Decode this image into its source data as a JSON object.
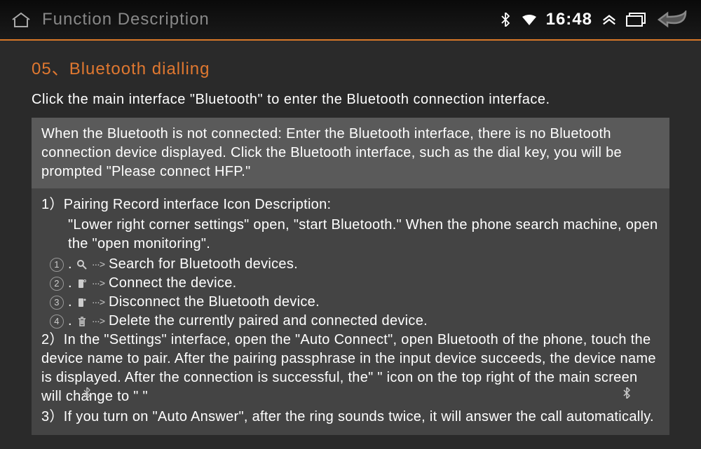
{
  "header": {
    "title": "Function Description",
    "time": "16:48"
  },
  "section": {
    "title": "05、Bluetooth dialling",
    "intro": "Click the main interface \"Bluetooth\" to enter the Bluetooth connection interface.",
    "infobox": "When the Bluetooth is not connected: Enter the Bluetooth interface, there is no Bluetooth connection device displayed. Click the Bluetooth interface, such as the dial key, you will be prompted \"Please connect HFP.\"",
    "item1_head": "1）Pairing Record interface Icon Description:",
    "item1_body": "\"Lower right corner settings\" open, \"start Bluetooth.\" When the phone search machine, open the \"open monitoring\".",
    "icon1_num": "1",
    "icon1_desc": "Search for Bluetooth devices.",
    "icon2_num": "2",
    "icon2_desc": "Connect the device.",
    "icon3_num": "3",
    "icon3_desc": "Disconnect the Bluetooth device.",
    "icon4_num": "4",
    "icon4_desc": "Delete the currently paired and connected device.",
    "item2": "2）In the \"Settings\" interface, open the \"Auto Connect\", open Bluetooth of the phone, touch the device name to pair. After the pairing passphrase in the input device succeeds, the device name is displayed. After the connection is successful, the\"     \" icon on the top right of the main screen will change to \"    \"",
    "item3": "3）If you turn on \"Auto Answer\", after the ring sounds twice, it will answer the call automatically.",
    "arrow": "···>"
  }
}
